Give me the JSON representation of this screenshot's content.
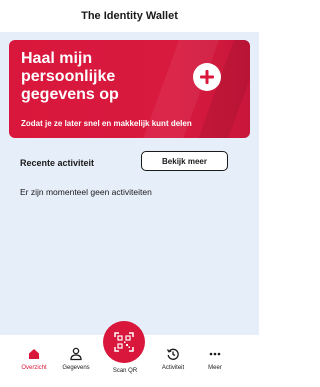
{
  "app": {
    "title": "The Identity Wallet"
  },
  "hero": {
    "headline_lines": [
      "Haal mijn",
      "persoonlijke",
      "gegevens op"
    ],
    "subtitle": "Zodat je ze later snel en makkelijk kunt delen",
    "icon": "plus-icon"
  },
  "recent": {
    "title": "Recente activiteit",
    "more_label": "Bekijk meer",
    "empty_text": "Er zijn momenteel geen activiteiten"
  },
  "nav": {
    "items": [
      {
        "label": "Overzicht",
        "icon": "home-icon",
        "active": true
      },
      {
        "label": "Gegevens",
        "icon": "person-icon",
        "active": false
      },
      {
        "label": "Scan QR",
        "icon": "qr-scan-icon",
        "active": false
      },
      {
        "label": "Activiteit",
        "icon": "history-icon",
        "active": false
      },
      {
        "label": "Meer",
        "icon": "more-icon",
        "active": false
      }
    ]
  },
  "colors": {
    "accent": "#d9173c",
    "content_background": "#e6eef9"
  }
}
